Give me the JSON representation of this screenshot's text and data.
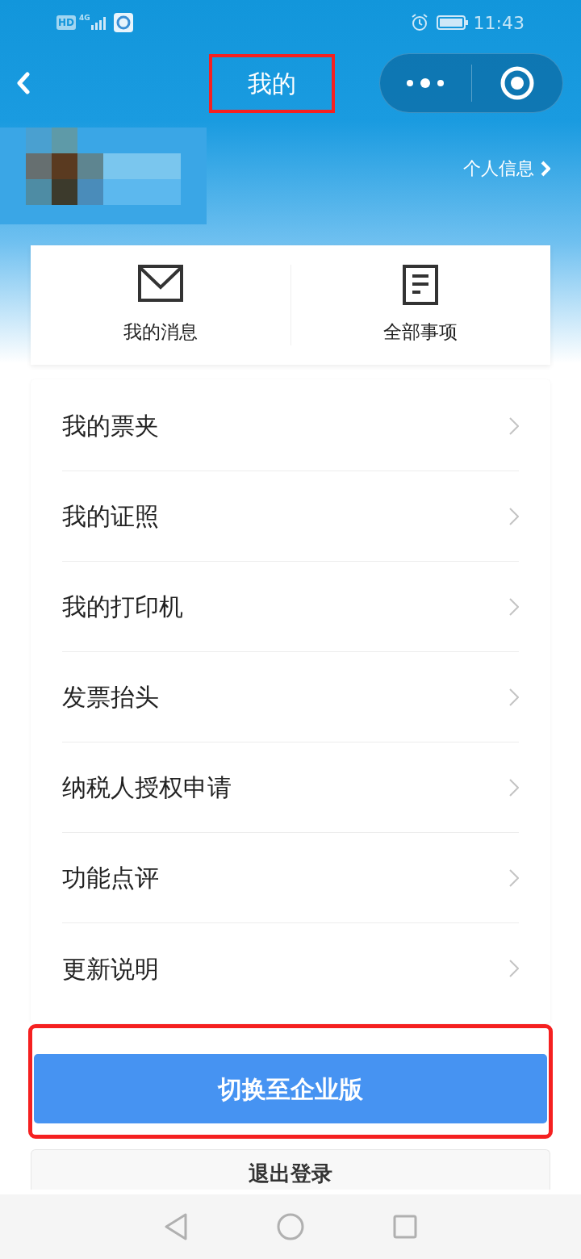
{
  "status_bar": {
    "hd": "HD",
    "network": "4G",
    "time": "11:43"
  },
  "header": {
    "title": "我的",
    "title_highlighted": true
  },
  "profile": {
    "info_link": "个人信息"
  },
  "quick_actions": [
    {
      "kind": "mail",
      "label": "我的消息"
    },
    {
      "kind": "document",
      "label": "全部事项"
    }
  ],
  "menu": [
    {
      "label": "我的票夹"
    },
    {
      "label": "我的证照"
    },
    {
      "label": "我的打印机"
    },
    {
      "label": "发票抬头"
    },
    {
      "label": "纳税人授权申请"
    },
    {
      "label": "功能点评"
    },
    {
      "label": "更新说明"
    }
  ],
  "switch_button": {
    "label": "切换至企业版",
    "highlighted": true
  },
  "logout_button": {
    "label": "退出登录"
  }
}
